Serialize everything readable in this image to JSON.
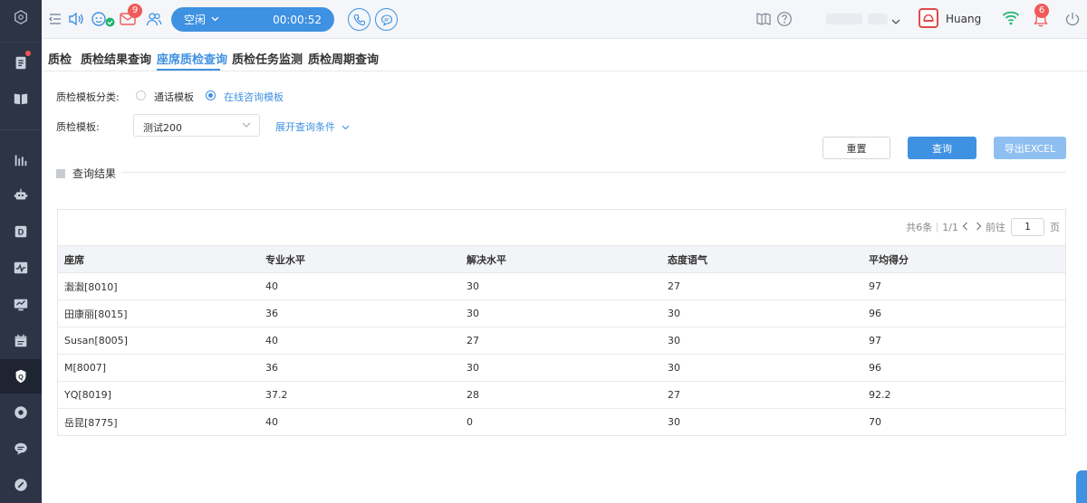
{
  "topbar": {
    "mail_badge": "9",
    "status_label": "空闲",
    "timer": "00:00:52",
    "username": "Huang",
    "bell_badge": "6"
  },
  "tabs": [
    {
      "label": "质检"
    },
    {
      "label": "质检结果查询"
    },
    {
      "label": "座席质检查询"
    },
    {
      "label": "质检任务监测"
    },
    {
      "label": "质检周期查询"
    }
  ],
  "form": {
    "category_label": "质检模板分类:",
    "radio_call": "通话模板",
    "radio_online": "在线咨询模板",
    "template_label": "质检模板:",
    "template_value": "测试200",
    "expand_label": "展开查询条件"
  },
  "buttons": {
    "reset": "重置",
    "query": "查询",
    "export": "导出EXCEL"
  },
  "section": {
    "title": "查询结果"
  },
  "pager": {
    "total": "共6条",
    "pages": "1/1",
    "goto": "前往",
    "page_value": "1",
    "page_unit": "页"
  },
  "table": {
    "headers": [
      "座席",
      "专业水平",
      "解决水平",
      "态度语气",
      "平均得分"
    ],
    "rows": [
      [
        "瀫瀫[8010]",
        "40",
        "30",
        "27",
        "97"
      ],
      [
        "田康丽[8015]",
        "36",
        "30",
        "30",
        "96"
      ],
      [
        "Susan[8005]",
        "40",
        "27",
        "30",
        "97"
      ],
      [
        "M[8007]",
        "36",
        "30",
        "30",
        "96"
      ],
      [
        "YQ[8019]",
        "37.2",
        "28",
        "27",
        "92.2"
      ],
      [
        "岳昆[8775]",
        "40",
        "0",
        "30",
        "70"
      ]
    ]
  },
  "colors": {
    "accent": "#3f91e2",
    "sidebar": "#2c3446",
    "badge": "#f05a5a"
  }
}
